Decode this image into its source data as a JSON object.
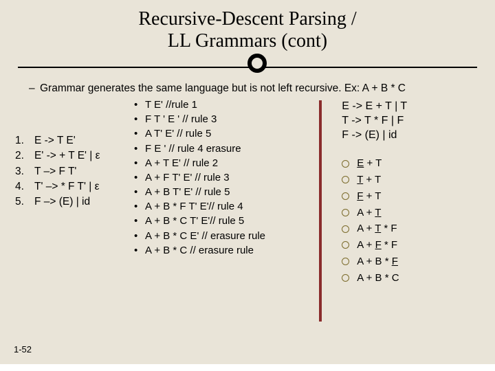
{
  "title_line1": "Recursive-Descent Parsing /",
  "title_line2": "LL Grammars (cont)",
  "intro": "Grammar generates the same language but is not left recursive. Ex: A + B * C",
  "rules": [
    {
      "n": "1.",
      "text": "E -> T E'"
    },
    {
      "n": "2.",
      "text": "E' -> + T E' | ε"
    },
    {
      "n": "3.",
      "text": "T –> F T'"
    },
    {
      "n": "4.",
      "text": "T' –> * F T' | ε"
    },
    {
      "n": "5.",
      "text": "F –> (E) | id"
    }
  ],
  "trace": [
    "T E'  //rule 1",
    "F T ' E ' // rule 3",
    "A T' E'  // rule 5",
    "F E ' // rule 4 erasure",
    "A + T E'  // rule 2",
    "A + F T' E' // rule 3",
    "A + B T' E' // rule 5",
    "A + B * F T' E'// rule 4",
    "A + B * C T' E'// rule 5",
    "A + B * C E' // erasure rule",
    "A + B * C // erasure rule"
  ],
  "original": [
    "E -> E + T | T",
    "T -> T * F | F",
    "F -> (E) | id"
  ],
  "deriv": [
    [
      {
        "t": "E",
        "u": true
      },
      {
        "t": " + T"
      }
    ],
    [
      {
        "t": "T",
        "u": true
      },
      {
        "t": " + T"
      }
    ],
    [
      {
        "t": "F",
        "u": true
      },
      {
        "t": " + T"
      }
    ],
    [
      {
        "t": "A + "
      },
      {
        "t": "T",
        "u": true
      }
    ],
    [
      {
        "t": "A + "
      },
      {
        "t": "T",
        "u": true
      },
      {
        "t": " * F"
      }
    ],
    [
      {
        "t": "A + "
      },
      {
        "t": "F",
        "u": true
      },
      {
        "t": " * F"
      }
    ],
    [
      {
        "t": "A + B * "
      },
      {
        "t": "F",
        "u": true
      }
    ],
    [
      {
        "t": "A + B * C"
      }
    ]
  ],
  "page": "1-52"
}
